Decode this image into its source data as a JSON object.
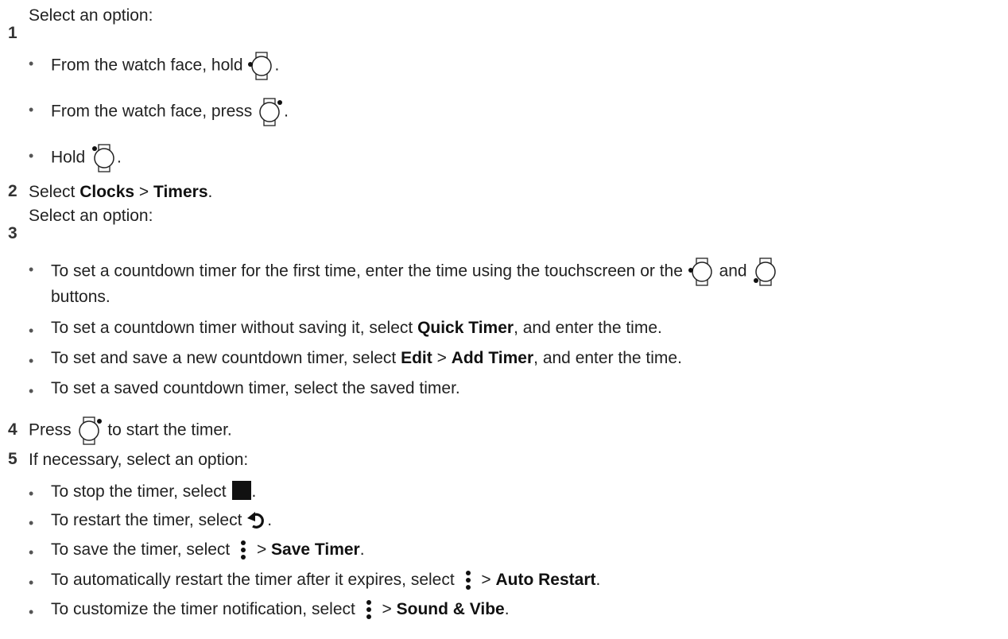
{
  "step1": {
    "number": "1",
    "text": "Select an option:",
    "bullets": [
      {
        "pre": "From the watch face, hold ",
        "post": ".",
        "icon": "watch-button-left-top-icon"
      },
      {
        "pre": "From the watch face, press ",
        "post": ".",
        "icon": "watch-button-right-top-icon"
      },
      {
        "pre": "Hold ",
        "post": ".",
        "icon": "watch-button-left-top-icon"
      }
    ]
  },
  "step2": {
    "number": "2",
    "pre": "Select ",
    "b1": "Clocks",
    "sep": " > ",
    "b2": "Timers",
    "post": "."
  },
  "step3": {
    "number": "3",
    "text": "Select an option:",
    "bullet1": {
      "pre": "To set a countdown timer for the first time, enter the time using the touchscreen or the ",
      "mid": " and ",
      "line2": "buttons."
    },
    "bullet2": {
      "pre": "To set a countdown timer without saving it, select ",
      "b": "Quick Timer",
      "post": ", and enter the time."
    },
    "bullet3": {
      "pre": "To set and save a new countdown timer, select ",
      "b1": "Edit",
      "sep": " > ",
      "b2": "Add Timer",
      "post": ", and enter the time."
    },
    "bullet4": {
      "text": "To set a saved countdown timer, select the saved timer."
    }
  },
  "step4": {
    "number": "4",
    "pre": "Press ",
    "post": " to start the timer."
  },
  "step5": {
    "number": "5",
    "text": "If necessary, select an option:",
    "b1": {
      "pre": "To stop the timer, select ",
      "post": ".",
      "icon": "stop-icon"
    },
    "b2": {
      "pre": "To restart the timer, select ",
      "post": ".",
      "icon": "restart-icon"
    },
    "b3": {
      "pre": "To save the timer, select ",
      "sep": " > ",
      "b": "Save Timer",
      "post": ".",
      "icon": "menu-icon"
    },
    "b4": {
      "pre": "To automatically restart the timer after it expires, select ",
      "sep": " > ",
      "b": "Auto Restart",
      "post": ".",
      "icon": "menu-icon"
    },
    "b5": {
      "pre": "To customize the timer notification, select ",
      "sep": " > ",
      "b": "Sound & Vibe",
      "post": ".",
      "icon": "menu-icon"
    }
  }
}
